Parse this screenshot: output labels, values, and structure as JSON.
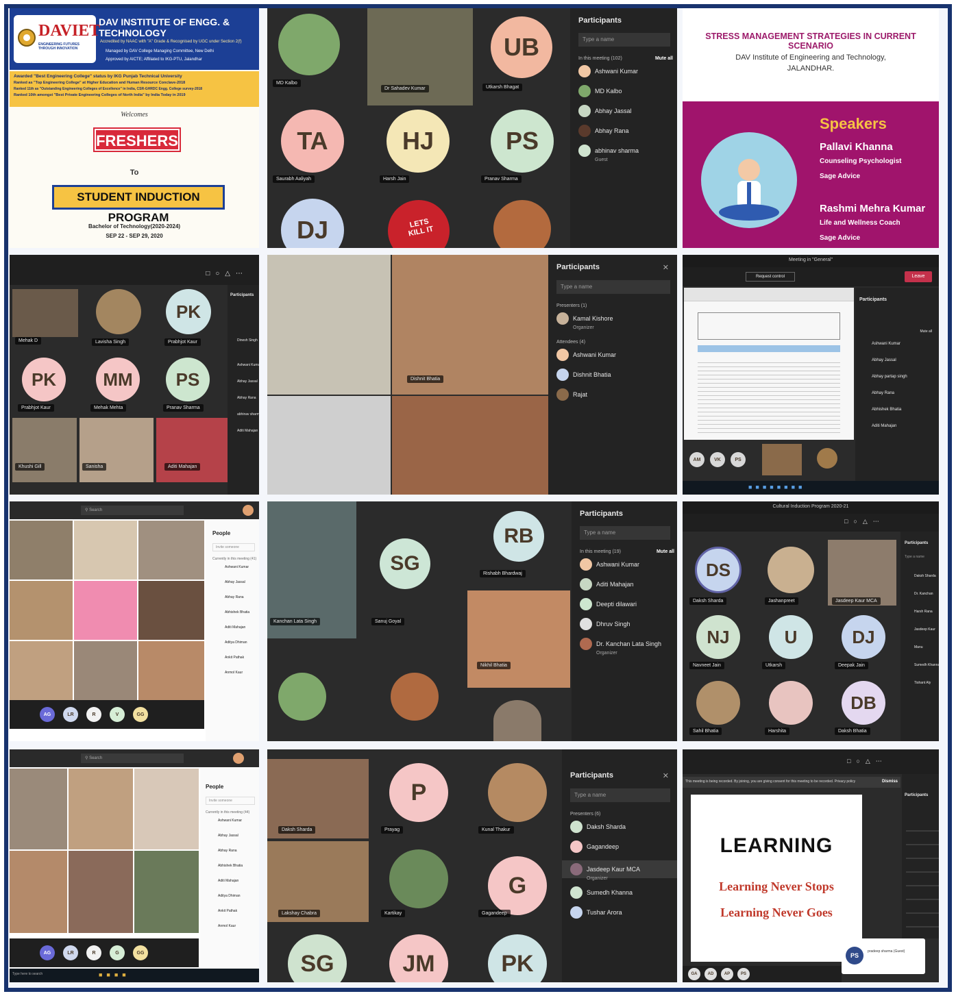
{
  "poster": {
    "logo": "DAVIET",
    "logo_tagline": "ENGINEERING FUTURES THROUGH INNOVATION",
    "institute": "DAV INSTITUTE OF ENGG. & TECHNOLOGY",
    "accreditation": "Accredited by NAAC with \"A\" Grade & Recognised by UGC under Section 2(f)",
    "managed_by": "Managed by DAV College Managing Committee, New Delhi",
    "approved": "Approved by AICTE; Affiliated to IKG-PTU, Jalandhar",
    "awards": [
      "Awarded \"Best Engineering College\" status by IKG Punjab Technical University",
      "Ranked as \"Top Engineering College\" at Higher Education and Human Resource Conclave-2018",
      "Ranked 11th as \"Outstanding Engineering Colleges of Excellence\" in India, CSR-GHRDC Engg. College survey-2018",
      "Ranked 10th amongst \"Best Private Engineering Colleges of North India\" by India Today in 2019"
    ],
    "welcomes": "Welcomes",
    "freshers": "FRESHERS",
    "to": "To",
    "program": "STUDENT INDUCTION PROGRAM",
    "degree": "Bachelor of Technology(2020-2024)",
    "dates": "SEP 22 - SEP 29, 2020"
  },
  "call1": {
    "tiles": [
      {
        "initials": "UB",
        "name": "Utkarsh Bhagat"
      },
      {
        "initials": "TA",
        "name": "Saurabh Aaliyah"
      },
      {
        "initials": "HJ",
        "name": "Harsh Jain"
      },
      {
        "initials": "PS",
        "name": "Pranav Sharma"
      },
      {
        "initials": "DJ",
        "name": ""
      }
    ],
    "video_names": [
      "MD Kalbo",
      "Dr Sahadev Kumar"
    ],
    "lets_kill_it": "LETS KILL IT",
    "panel": {
      "title": "Participants",
      "search": "Type a name",
      "section": "In this meeting (102)",
      "mute_all": "Mute all",
      "people": [
        "Ashwani Kumar",
        "MD Kalbo",
        "Abhay Jassal",
        "Abhay Rana",
        "abhinav sharma"
      ],
      "guest_label": "Guest"
    }
  },
  "stress": {
    "title": "STRESS MANAGEMENT STRATEGIES IN CURRENT SCENARIO",
    "institute": "DAV Institute of Engineering and Technology,",
    "city": "JALANDHAR.",
    "speakers_heading": "Speakers",
    "speaker1_name": "Pallavi Khanna",
    "speaker1_role": "Counseling Psychologist",
    "speaker1_org": "Sage Advice",
    "speaker2_name": "Rashmi Mehra Kumar",
    "speaker2_role": "Life and Wellness Coach",
    "speaker2_org": "Sage Advice"
  },
  "call2": {
    "tiles": [
      {
        "initials": "PK",
        "name": "Prabhjot Kaur"
      },
      {
        "initials": "PK",
        "name": "Prabhjot Kaur"
      },
      {
        "initials": "MM",
        "name": "Mehak Mehta"
      },
      {
        "initials": "PS",
        "name": "Pranav Sharma"
      }
    ],
    "video_names": [
      "Mehak D",
      "Lavisha Singh",
      "Khushi Gill",
      "Sanisha",
      "Aditi Mahajan"
    ],
    "panel_title": "Participants",
    "panel_people": [
      "Dinesh Singh",
      "Ashwani Kumar",
      "Abhay Jassal",
      "Abhay Rana",
      "abhinav sharma",
      "Aditi Mahajan"
    ]
  },
  "call3": {
    "video_names": [
      "Dishnit Bhatia",
      "Kamal Kishore"
    ],
    "panel": {
      "title": "Participants",
      "search": "Type a name",
      "presenters": "Presenters (1)",
      "attendees": "Attendees (4)",
      "presenter": {
        "name": "Kamal Kishore",
        "role": "Organizer"
      },
      "people": [
        "Ashwani Kumar",
        "Dishnit Bhatia",
        "Rajat"
      ]
    }
  },
  "call4": {
    "title": "Meeting in \"General\"",
    "request_control": "Request control",
    "leave": "Leave",
    "panel_title": "Participants",
    "mute_all": "Mute all",
    "panel_people": [
      "Ashwani Kumar",
      "Abhay Jassal",
      "Abhay partap singh",
      "Abhay Rana",
      "Abhishek Bhatia",
      "Aditi Mahajan"
    ],
    "avatars": [
      "AM",
      "VK",
      "PS"
    ]
  },
  "call5": {
    "search": "Search",
    "panel_title": "People",
    "panel_search": "Invite someone",
    "panel_section": "Currently in this meeting (41)",
    "panel_people": [
      "Ashwani Kumar",
      "Abhay Jassal",
      "Abhay Rana",
      "Abhishek Bhatia",
      "Aditi Mahajan",
      "Aditya Dhiman",
      "Ankit Pathak",
      "Anmol Kaur"
    ],
    "avatars": [
      "AG",
      "LR",
      "R",
      "V",
      "GG"
    ]
  },
  "call6": {
    "tiles": [
      {
        "initials": "SG",
        "name": "Sanuj Goyal"
      },
      {
        "initials": "RB",
        "name": "Rishabh Bhardwaj"
      }
    ],
    "video_names": [
      "Kanchan Lata Singh",
      "Nikhil Bhatia"
    ],
    "panel": {
      "title": "Participants",
      "search": "Type a name",
      "section": "In this meeting (19)",
      "mute_all": "Mute all",
      "people": [
        "Ashwani Kumar",
        "Aditi Mahajan",
        "Deepti dilawari",
        "Dhruv Singh",
        "Dr. Kanchan Lata Singh"
      ],
      "organizer": "Organizer"
    }
  },
  "call7": {
    "title": "Cultural Induction Program 2020-21",
    "tiles": [
      {
        "initials": "DS",
        "name": "Daksh Sharda"
      },
      {
        "initials": "NJ",
        "name": "Navneet Jain"
      },
      {
        "initials": "U",
        "name": "Utkarsh"
      },
      {
        "initials": "DJ",
        "name": "Deepak Jain"
      },
      {
        "initials": "DB",
        "name": "Daksh Bhatia"
      }
    ],
    "video_names": [
      "Jashanpreet",
      "Jasdeep Kaur MCA",
      "Sahil Bhatia",
      "Harshita"
    ],
    "panel_title": "Participants",
    "panel_search": "Type a name",
    "panel_people": [
      "Daksh Sharda",
      "Dr. Kanchan",
      "Harsh Rana",
      "Jasdeep Kaur",
      "Manu",
      "Sumedh Khanna",
      "Tishant Aly"
    ]
  },
  "call8": {
    "search": "Search",
    "panel_title": "People",
    "panel_search": "Invite someone",
    "panel_section": "Currently in this meeting (44)",
    "panel_people": [
      "Ashwani Kumar",
      "Abhay Jassal",
      "Abhay Rana",
      "Abhishek Bhatia",
      "Aditi Mahajan",
      "Aditya Dhiman",
      "Ankit Pathak",
      "Anmol Kaur"
    ],
    "avatars": [
      "AG",
      "LR",
      "R",
      "G",
      "GG"
    ],
    "search_bar": "Type here to search"
  },
  "call9": {
    "tiles": [
      {
        "initials": "P",
        "name": "Prayag"
      },
      {
        "initials": "G",
        "name": "Gagandeep"
      },
      {
        "initials": "SG",
        "name": ""
      },
      {
        "initials": "JM",
        "name": ""
      },
      {
        "initials": "PK",
        "name": ""
      }
    ],
    "video_names": [
      "Daksh Sharda",
      "Kunal Thakur",
      "Lakshay Chabra",
      "Kartikay"
    ],
    "panel": {
      "title": "Participants",
      "search": "Type a name",
      "presenters": "Presenters (6)",
      "people": [
        "Daksh Sharda",
        "Gagandeep",
        "Jasdeep Kaur MCA",
        "Sumedh Khanna",
        "Tushar Arora"
      ],
      "organizer": "Organizer"
    }
  },
  "call10": {
    "banner": "This meeting is being recorded. By joining, you are giving consent for this meeting to be recorded. Privacy policy",
    "dismiss": "Dismiss",
    "slide_heading": "LEARNING",
    "slide_line1": "Learning Never Stops",
    "slide_line2": "Learning Never Goes",
    "panel_title": "Participants",
    "presenter_initials": "PS",
    "presenter_name": "pradeep sharma (Guest)",
    "avatars": [
      "GA",
      "AD",
      "AP",
      "PS"
    ]
  },
  "colors": {
    "frame": "#18336e",
    "teams_dark": "#2b2b2b",
    "stress_magenta": "#a0146c",
    "poster_yellow": "#f6c343",
    "freshers_red": "#d8293a",
    "leave_red": "#c4314b"
  }
}
